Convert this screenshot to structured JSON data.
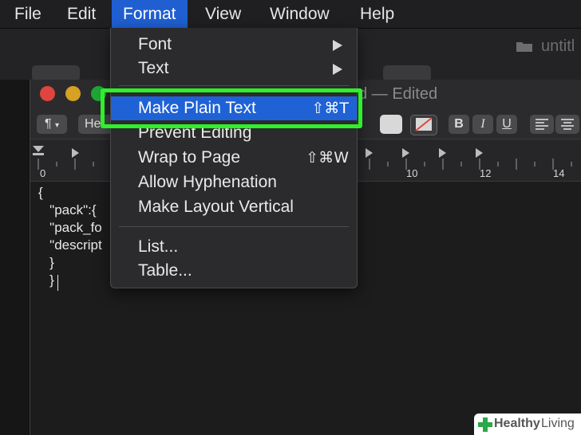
{
  "menubar": {
    "items": [
      {
        "label": "File"
      },
      {
        "label": "Edit"
      },
      {
        "label": "Format"
      },
      {
        "label": "View"
      },
      {
        "label": "Window"
      },
      {
        "label": "Help"
      }
    ],
    "active": "Format"
  },
  "background": {
    "title_fragment": "untitl"
  },
  "window": {
    "title": "ed — Edited",
    "toolbar": {
      "paragraph_button": "¶",
      "font_fragment": "Hel",
      "bold": "B",
      "italic": "I",
      "underline": "U"
    },
    "ruler": {
      "labels": [
        "0",
        "10",
        "12",
        "14"
      ]
    },
    "document_lines": [
      "{",
      "   \"pack\":{",
      "   \"pack_fo",
      "   \"descript",
      "   }",
      "   }"
    ]
  },
  "format_menu": {
    "items": [
      {
        "label": "Font",
        "submenu": true
      },
      {
        "label": "Text",
        "submenu": true
      },
      {
        "label": "Make Plain Text",
        "shortcut": "⇧⌘T",
        "highlighted": true
      },
      {
        "label": "Prevent Editing"
      },
      {
        "label": "Wrap to Page",
        "shortcut": "⇧⌘W"
      },
      {
        "label": "Allow Hyphenation"
      },
      {
        "label": "Make Layout Vertical"
      },
      {
        "label": "List..."
      },
      {
        "label": "Table..."
      }
    ]
  },
  "watermark": {
    "brand_bold": "Healthy",
    "brand_light": "Living"
  },
  "colors": {
    "menu_highlight": "#1f62d6",
    "callout": "#2ef02a",
    "close": "#e0443e",
    "minimize": "#d6a124",
    "zoom": "#1fa637"
  },
  "icons": [
    "folder-icon",
    "submenu-arrow-icon",
    "tab-stop-icon",
    "text-color-icon",
    "health-cross-icon"
  ]
}
